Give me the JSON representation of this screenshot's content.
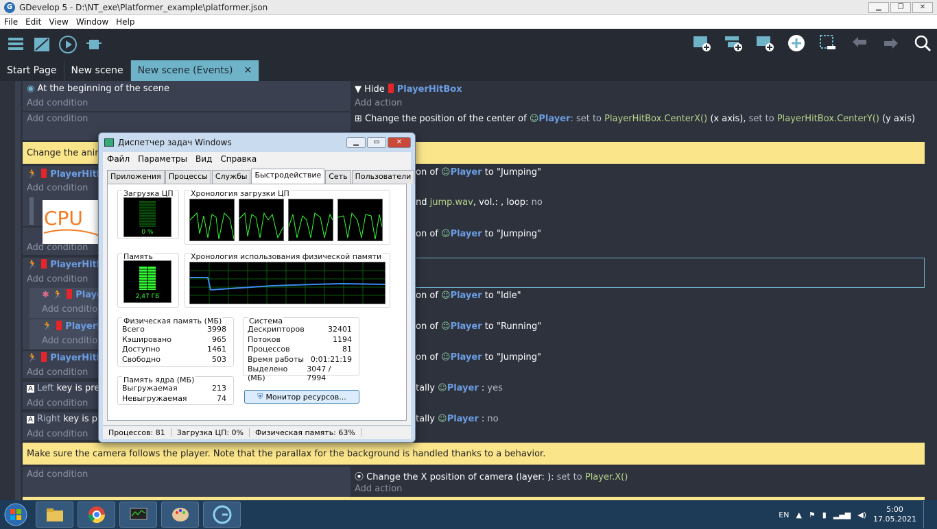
{
  "window": {
    "title": "GDevelop 5 - D:\\NT_exe\\Platformer_example\\platformer.json",
    "min": "▁",
    "max": "❐",
    "close": "✕"
  },
  "menu": [
    "File",
    "Edit",
    "View",
    "Window",
    "Help"
  ],
  "tabs": [
    {
      "label": "Start Page"
    },
    {
      "label": "New scene"
    },
    {
      "label": "New scene (Events)",
      "close": "✕"
    }
  ],
  "events": {
    "r1_cond": "At the beginning of the scene",
    "add_condition": "Add condition",
    "add_action": "Add action",
    "r1_act_hide": "Hide",
    "obj_hitbox": "PlayerHitBox",
    "obj_player": "Player",
    "r2_act_pre": "Change the position of the center of",
    "r2_act_set1": ": set to",
    "r2_act_v1": "PlayerHitBox.CenterX()",
    "r2_act_x": "(x axis),",
    "r2_act_set2": "set to",
    "r2_act_v2": "PlayerHitBox.CenterY()",
    "r2_act_y": "(y axis)",
    "comment1": "Change the anim",
    "frag_anim": "on of",
    "to": "to",
    "jumping": "\"Jumping\"",
    "idle": "\"Idle\"",
    "running": "\"Running\"",
    "frag_sound": "nd",
    "sound_file": "jump.wav",
    "sound_rest": ", vol.: , loop:",
    "no": "no",
    "yes": "yes",
    "frag_flip": "tally",
    "colon_sp": ":",
    "left_key": "Left",
    "right_key": "Right",
    "key_frag": "key is pre",
    "key_frag2": "key is p",
    "play_frag": "Playe",
    "play_frag2": "PlayerH",
    "hitbox_frag": "PlayerHitB",
    "comment2": "Make sure the camera follows the player. Note that the parallax for the background is handled thanks to a behavior.",
    "cam_act": "Change the X position of camera",
    "cam_layer": "(layer: ):",
    "cam_set": "set to",
    "cam_val": "Player.X()"
  },
  "taskmanager": {
    "title": "Диспетчер задач Windows",
    "menu": [
      "Файл",
      "Параметры",
      "Вид",
      "Справка"
    ],
    "tabs": [
      "Приложения",
      "Процессы",
      "Службы",
      "Быстродействие",
      "Сеть",
      "Пользователи"
    ],
    "cpu_label": "Загрузка ЦП",
    "cpu_value": "0 %",
    "cpu_history_label": "Хронология загрузки ЦП",
    "mem_label": "Память",
    "mem_value": "2,47 ГБ",
    "mem_history_label": "Хронология использования физической памяти",
    "phys": {
      "label": "Физическая память (МБ)",
      "rows": [
        [
          "Всего",
          "3998"
        ],
        [
          "Кэшировано",
          "965"
        ],
        [
          "Доступно",
          "1461"
        ],
        [
          "Свободно",
          "503"
        ]
      ]
    },
    "system": {
      "label": "Система",
      "rows": [
        [
          "Дескрипторов",
          "32401"
        ],
        [
          "Потоков",
          "1194"
        ],
        [
          "Процессов",
          "81"
        ],
        [
          "Время работы",
          "0:01:21:19"
        ],
        [
          "Выделено (МБ)",
          "3047 / 7994"
        ]
      ]
    },
    "kernel": {
      "label": "Память ядра (МБ)",
      "rows": [
        [
          "Выгружаемая",
          "213"
        ],
        [
          "Невыгружаемая",
          "74"
        ]
      ]
    },
    "resmon_button": "Монитор ресурсов...",
    "status": [
      "Процессов: 81",
      "Загрузка ЦП: 0%",
      "Физическая память: 63%"
    ]
  },
  "annotation": "CPU",
  "tray": {
    "lang": "EN",
    "time": "5:00",
    "date": "17.05.2021"
  }
}
